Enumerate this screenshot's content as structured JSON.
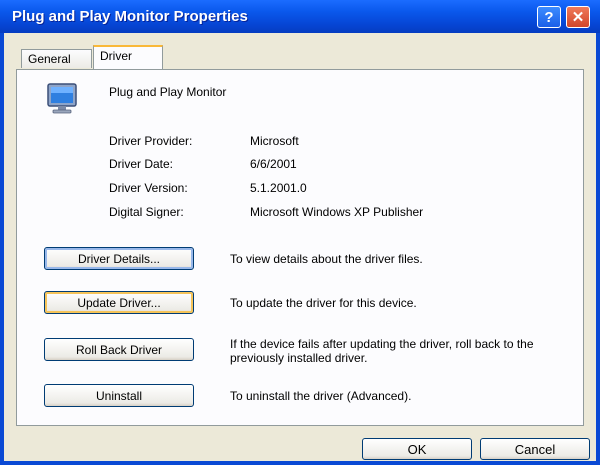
{
  "window": {
    "title": "Plug and Play Monitor Properties",
    "help_label": "?",
    "close_label": "✕"
  },
  "tabs": [
    {
      "label": "General",
      "selected": false
    },
    {
      "label": "Driver",
      "selected": true
    }
  ],
  "device": {
    "name": "Plug and Play Monitor",
    "icon": "monitor-icon"
  },
  "driver_info": [
    {
      "label": "Driver Provider:",
      "value": "Microsoft"
    },
    {
      "label": "Driver Date:",
      "value": "6/6/2001"
    },
    {
      "label": "Driver Version:",
      "value": "5.1.2001.0"
    },
    {
      "label": "Digital Signer:",
      "value": "Microsoft Windows XP Publisher"
    }
  ],
  "actions": [
    {
      "label": "Driver Details...",
      "description": "To view details about the driver files."
    },
    {
      "label": "Update Driver...",
      "description": "To update the driver for this device."
    },
    {
      "label": "Roll Back Driver",
      "description": "If the device fails after updating the driver, roll back to the previously installed driver."
    },
    {
      "label": "Uninstall",
      "description": "To uninstall the driver (Advanced)."
    }
  ],
  "footer": {
    "ok_label": "OK",
    "cancel_label": "Cancel"
  },
  "colors": {
    "titlebar": "#0a58ec",
    "dialog_bg": "#ece9d8",
    "button_border": "#003c74",
    "tab_highlight": "#f9b838"
  }
}
